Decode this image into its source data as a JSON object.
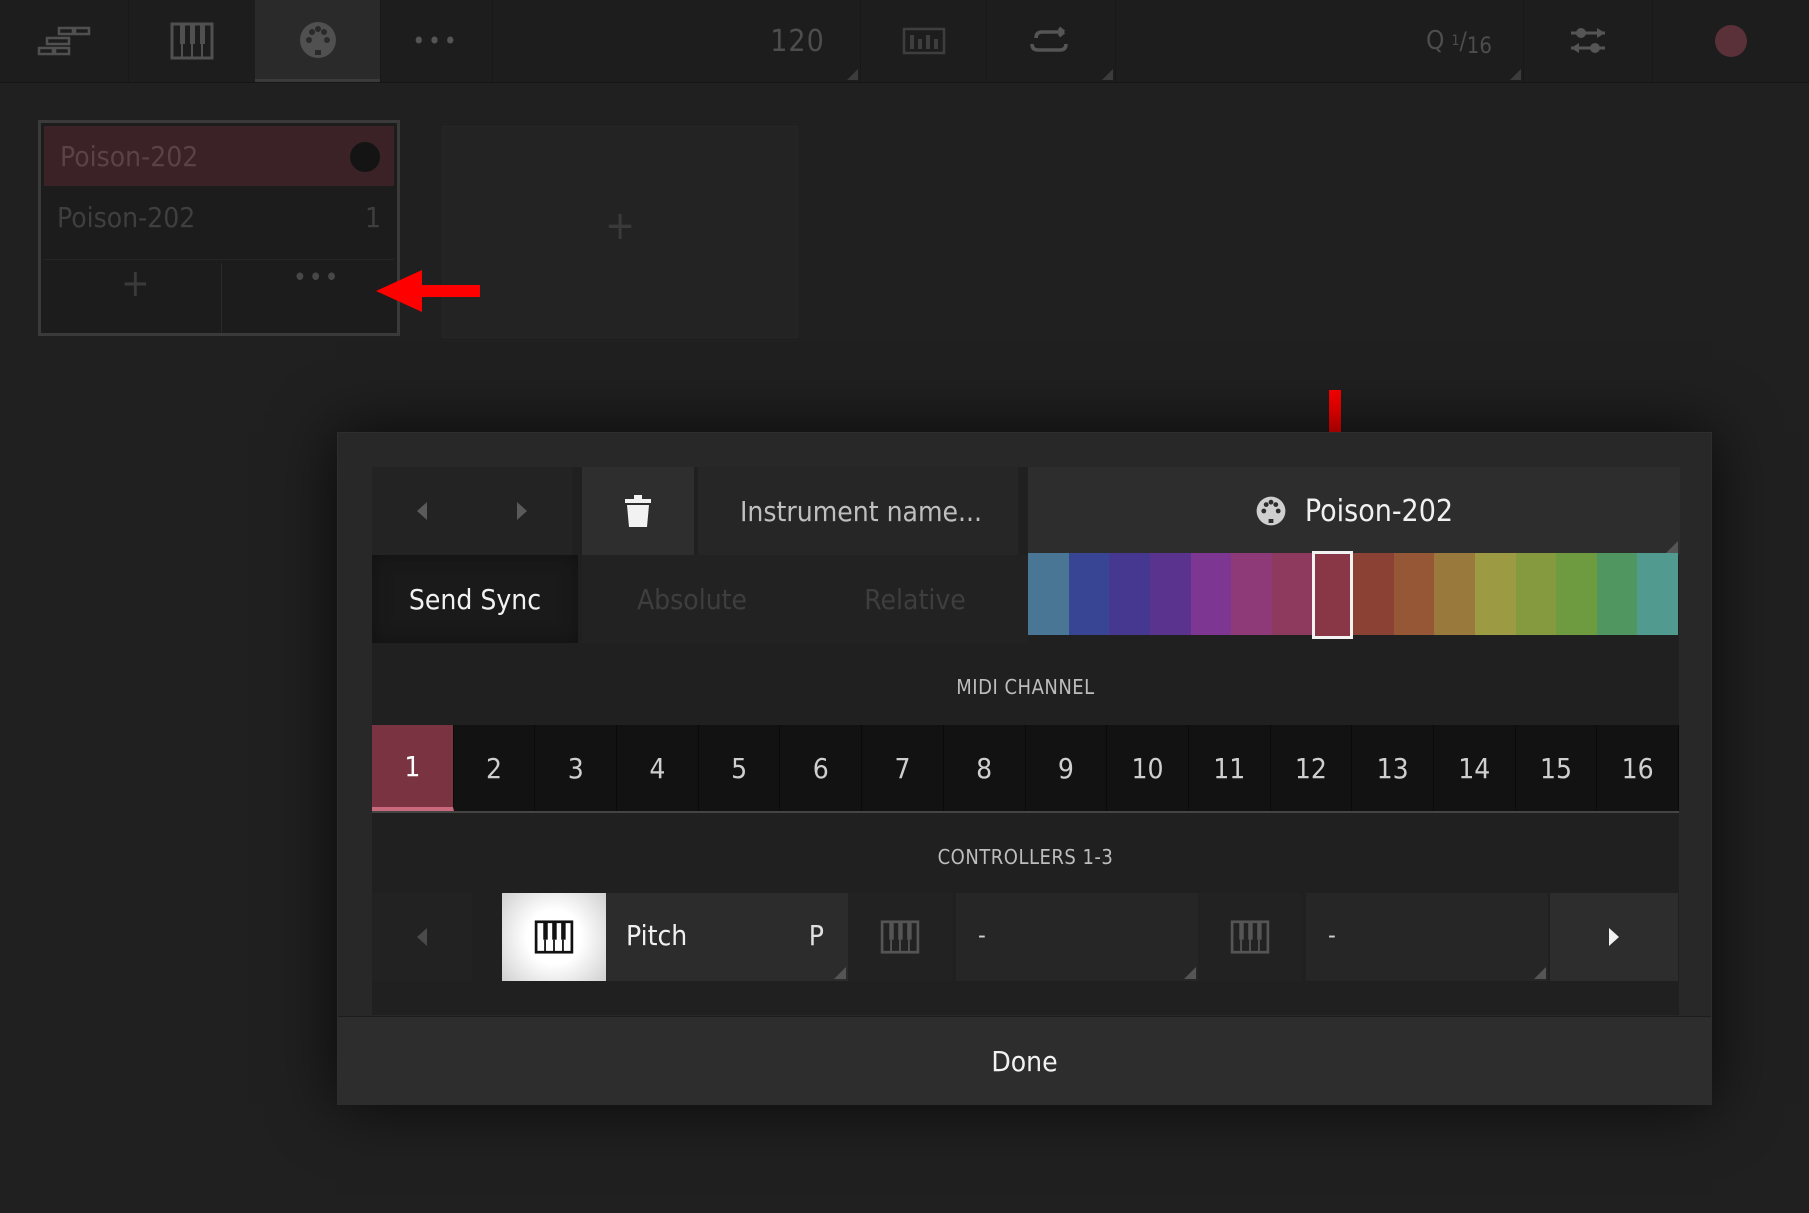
{
  "toolbar": {
    "tempo": "120",
    "quantize_label": "Q",
    "quantize_numerator": "1",
    "quantize_denominator": "16",
    "icons": [
      "arrange-icon",
      "keyboard-icon",
      "midi-port-icon",
      "more-icon",
      "metronome-icon",
      "loop-icon",
      "mixer-icon",
      "record-icon"
    ]
  },
  "instrument_card": {
    "title": "Poison-202",
    "row_name": "Poison-202",
    "row_channel": "1",
    "add_label": "+",
    "more_label": "•••"
  },
  "add_instrument": {
    "label": "+"
  },
  "modal": {
    "name_placeholder": "Instrument name...",
    "instrument_label": "Poison-202",
    "send_sync": "Send Sync",
    "absolute": "Absolute",
    "relative": "Relative",
    "palette": [
      "#4a7696",
      "#384594",
      "#463791",
      "#5a338e",
      "#7d3691",
      "#8e3a78",
      "#8e3a5e",
      "#893746",
      "#8b4133",
      "#955736",
      "#9a7a3c",
      "#9c9a42",
      "#859a3e",
      "#6e9a40",
      "#4f9660",
      "#519a90"
    ],
    "selected_color_index": 7,
    "midi_channel_label": "MIDI CHANNEL",
    "channels": [
      "1",
      "2",
      "3",
      "4",
      "5",
      "6",
      "7",
      "8",
      "9",
      "10",
      "11",
      "12",
      "13",
      "14",
      "15",
      "16"
    ],
    "selected_channel": "1",
    "controllers_label": "CONTROLLERS 1-3",
    "controller1": {
      "name": "Pitch",
      "short": "P"
    },
    "controller2": {
      "name": "-"
    },
    "controller3": {
      "name": "-"
    },
    "done": "Done"
  },
  "colors": {
    "accent": "#7a3441",
    "annotation": "#ff0000"
  }
}
